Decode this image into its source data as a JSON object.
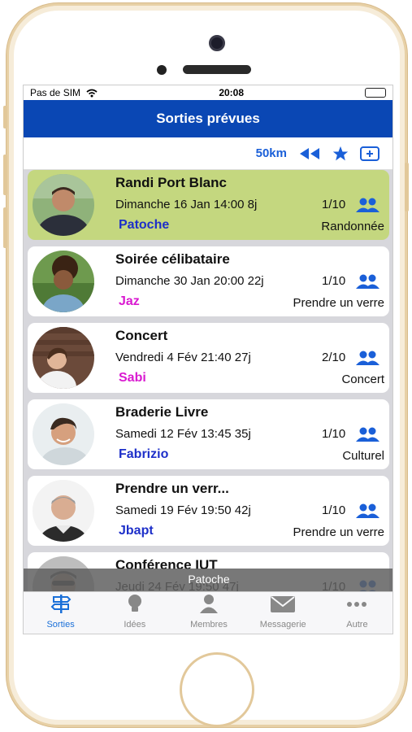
{
  "status": {
    "carrier": "Pas de SIM",
    "time": "20:08"
  },
  "header": {
    "title": "Sorties prévues"
  },
  "toolbar": {
    "distance": "50km"
  },
  "events": [
    {
      "title": "Randi Port Blanc",
      "date": "Dimanche 16 Jan 14:00 8j",
      "count": "1/10",
      "author": "Patoche",
      "author_color": "#1d2fc9",
      "category": "Randonnée",
      "highlighted": true
    },
    {
      "title": "Soirée célibataire",
      "date": "Dimanche 30 Jan 20:00 22j",
      "count": "1/10",
      "author": "Jaz",
      "author_color": "#d919d0",
      "category": "Prendre un verre",
      "highlighted": false
    },
    {
      "title": "Concert",
      "date": "Vendredi 4 Fév 21:40 27j",
      "count": "2/10",
      "author": "Sabi",
      "author_color": "#d919d0",
      "category": "Concert",
      "highlighted": false
    },
    {
      "title": "Braderie Livre",
      "date": "Samedi 12 Fév 13:45 35j",
      "count": "1/10",
      "author": "Fabrizio",
      "author_color": "#1d2fc9",
      "category": "Culturel",
      "highlighted": false
    },
    {
      "title": "Prendre un verr...",
      "date": "Samedi 19 Fév 19:50 42j",
      "count": "1/10",
      "author": "Jbapt",
      "author_color": "#1d2fc9",
      "category": "Prendre un verre",
      "highlighted": false
    },
    {
      "title": "Conférence IUT",
      "date": "Jeudi 24 Fév 19:50 47j",
      "count": "1/10",
      "author": "",
      "author_color": "#1d2fc9",
      "category": "",
      "highlighted": false
    }
  ],
  "toast": {
    "text": "Patoche"
  },
  "tabs": [
    {
      "label": "Sorties",
      "icon": "signpost-icon",
      "active": true
    },
    {
      "label": "Idées",
      "icon": "lightbulb-icon",
      "active": false
    },
    {
      "label": "Membres",
      "icon": "person-icon",
      "active": false
    },
    {
      "label": "Messagerie",
      "icon": "envelope-icon",
      "active": false
    },
    {
      "label": "Autre",
      "icon": "more-icon",
      "active": false
    }
  ],
  "colors": {
    "accent": "#0a47b4",
    "highlight": "#c4d77f",
    "link_blue": "#1d2fc9",
    "link_pink": "#d919d0"
  }
}
